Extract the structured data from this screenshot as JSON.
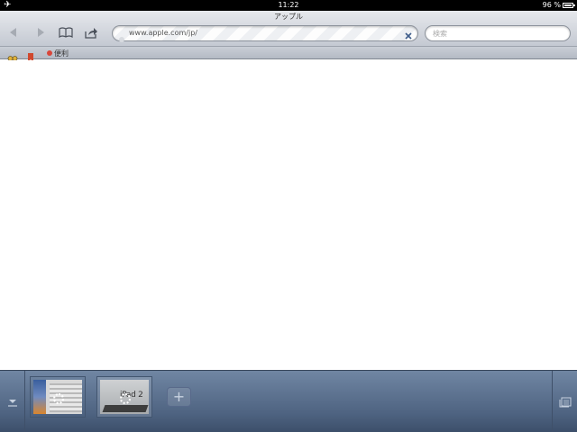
{
  "status_bar": {
    "airplane_icon": "airplane-icon",
    "time": "11:22",
    "battery_percent": "96 %",
    "battery_level": 0.96
  },
  "toolbar": {
    "page_title": "アップル",
    "back_icon": "back-arrow-icon",
    "forward_icon": "forward-arrow-icon",
    "bookmarks_icon": "open-book-icon",
    "share_icon": "share-icon",
    "url": "www.apple.com/jp/",
    "clear_icon": "clear-x-icon",
    "search_placeholder": "検索"
  },
  "bookmarks_bar": {
    "reading_list_icon": "glasses-icon",
    "bookmark_icon": "bookmark-ribbon-icon",
    "items": [
      {
        "label": "便利",
        "dot_color": "#d9463a"
      }
    ]
  },
  "tab_drawer": {
    "collapse_icon": "collapse-down-icon",
    "tabs": [
      {
        "name": "tab-1",
        "active": false
      },
      {
        "name": "tab-2",
        "active": true,
        "thumb_text": "iPad 2"
      }
    ],
    "add_tab_label": "+",
    "tab_list_icon": "tab-list-icon",
    "accent": "#566b89"
  }
}
